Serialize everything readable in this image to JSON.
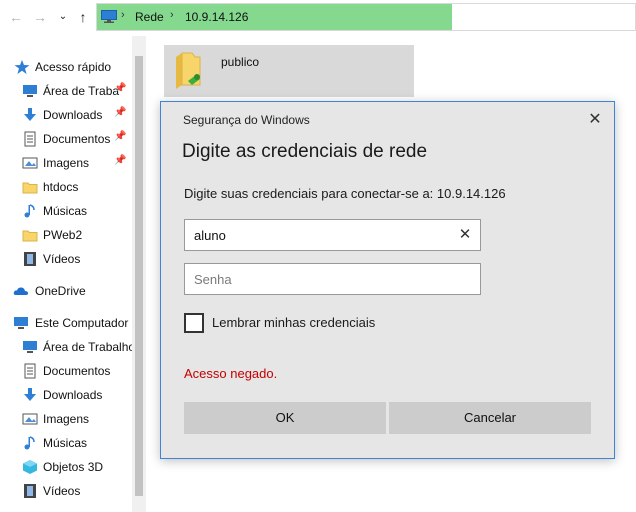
{
  "address": {
    "crumbs": [
      "Rede",
      "10.9.14.126"
    ],
    "separator": "›",
    "progress_fraction": 0.66,
    "progress_color": "#84d98f"
  },
  "nav": {
    "back_icon": "arrow-left-icon",
    "forward_icon": "arrow-right-icon",
    "history_icon": "chevron-down-icon",
    "up_icon": "arrow-up-icon"
  },
  "sidebar": {
    "quick_access": "Acesso rápido",
    "quick_items": [
      {
        "label": "Área de Traba",
        "icon": "desktop-icon",
        "pinned": true
      },
      {
        "label": "Downloads",
        "icon": "download-icon",
        "pinned": true
      },
      {
        "label": "Documentos",
        "icon": "documents-icon",
        "pinned": true
      },
      {
        "label": "Imagens",
        "icon": "pictures-icon",
        "pinned": true
      },
      {
        "label": "htdocs",
        "icon": "folder-icon",
        "pinned": false
      },
      {
        "label": "Músicas",
        "icon": "music-icon",
        "pinned": false
      },
      {
        "label": "PWeb2",
        "icon": "folder-icon",
        "pinned": false
      },
      {
        "label": "Vídeos",
        "icon": "videos-icon",
        "pinned": false
      }
    ],
    "onedrive": "OneDrive",
    "this_pc": "Este Computador",
    "pc_items": [
      {
        "label": "Área de Trabalho",
        "icon": "desktop-icon"
      },
      {
        "label": "Documentos",
        "icon": "documents-icon"
      },
      {
        "label": "Downloads",
        "icon": "download-icon"
      },
      {
        "label": "Imagens",
        "icon": "pictures-icon"
      },
      {
        "label": "Músicas",
        "icon": "music-icon"
      },
      {
        "label": "Objetos 3D",
        "icon": "objects-3d-icon"
      },
      {
        "label": "Vídeos",
        "icon": "videos-icon"
      }
    ]
  },
  "content": {
    "share": {
      "label": "publico",
      "icon": "shared-folder-icon"
    }
  },
  "dialog": {
    "title": "Segurança do Windows",
    "heading": "Digite as credenciais de rede",
    "prompt": "Digite suas credenciais para conectar-se a: 10.9.14.126",
    "username_value": "aluno",
    "password_placeholder": "Senha",
    "remember_label": "Lembrar minhas credenciais",
    "remember_checked": false,
    "error": "Acesso negado.",
    "ok_label": "OK",
    "cancel_label": "Cancelar",
    "close_icon": "close-icon",
    "accent_color": "#3d83d8",
    "error_color": "#c40000"
  }
}
